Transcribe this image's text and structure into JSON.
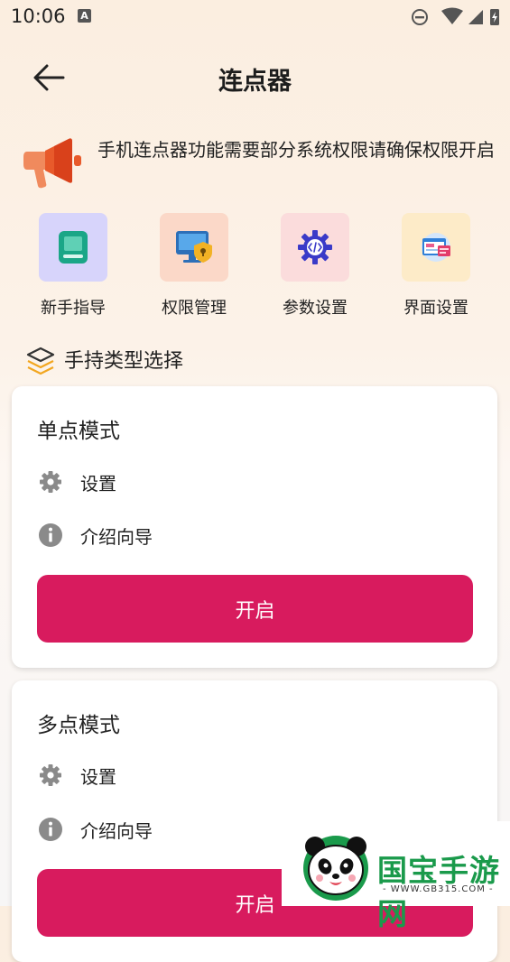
{
  "status_bar": {
    "time": "10:06",
    "badge": "A"
  },
  "header": {
    "title": "连点器"
  },
  "notice": {
    "text": "手机连点器功能需要部分系统权限请确保权限开启"
  },
  "features": [
    {
      "label": "新手指导",
      "bg": "#d7d4fb",
      "icon": "book-icon"
    },
    {
      "label": "权限管理",
      "bg": "#fbd8c8",
      "icon": "monitor-shield-icon"
    },
    {
      "label": "参数设置",
      "bg": "#fbdcdc",
      "icon": "code-gear-icon"
    },
    {
      "label": "界面设置",
      "bg": "#fdebc8",
      "icon": "interface-icon"
    }
  ],
  "section": {
    "title": "手持类型选择"
  },
  "modes": [
    {
      "title": "单点模式",
      "settings": "设置",
      "guide": "介绍向导",
      "button": "开启"
    },
    {
      "title": "多点模式",
      "settings": "设置",
      "guide": "介绍向导",
      "button": "开启"
    }
  ],
  "watermark": {
    "brand": "国宝手游网",
    "url": "- WWW.GB315.COM -"
  },
  "colors": {
    "accent": "#d81b5e",
    "icon_gray": "#8a8a8a"
  }
}
